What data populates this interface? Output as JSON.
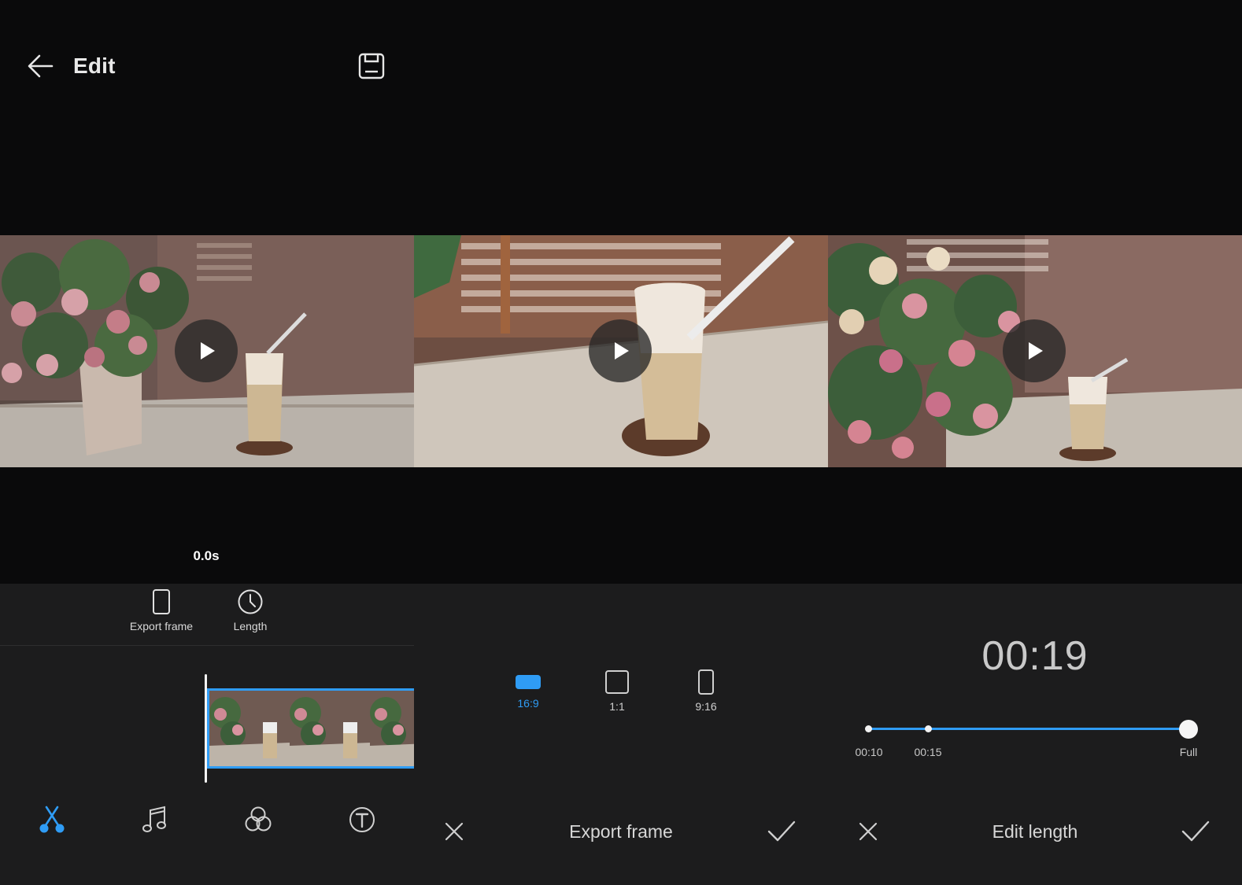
{
  "header": {
    "title": "Edit"
  },
  "preview": {
    "timecode": "0.0s"
  },
  "toolbar": {
    "export_frame_label": "Export frame",
    "length_label": "Length"
  },
  "export_frame": {
    "ratios": [
      {
        "label": "16:9",
        "active": true
      },
      {
        "label": "1:1",
        "active": false
      },
      {
        "label": "9:16",
        "active": false
      }
    ],
    "title": "Export frame"
  },
  "edit_length": {
    "duration": "00:19",
    "marks": [
      "00:10",
      "00:15",
      "Full"
    ],
    "selected": "Full",
    "title": "Edit length"
  },
  "bottom_nav": {
    "items": [
      "scissors-icon",
      "music-icon",
      "filter-icon",
      "text-icon"
    ],
    "active": "scissors-icon"
  },
  "colors": {
    "accent": "#2f9cf5",
    "panel": "#1c1c1d",
    "background": "#0a0a0b"
  }
}
